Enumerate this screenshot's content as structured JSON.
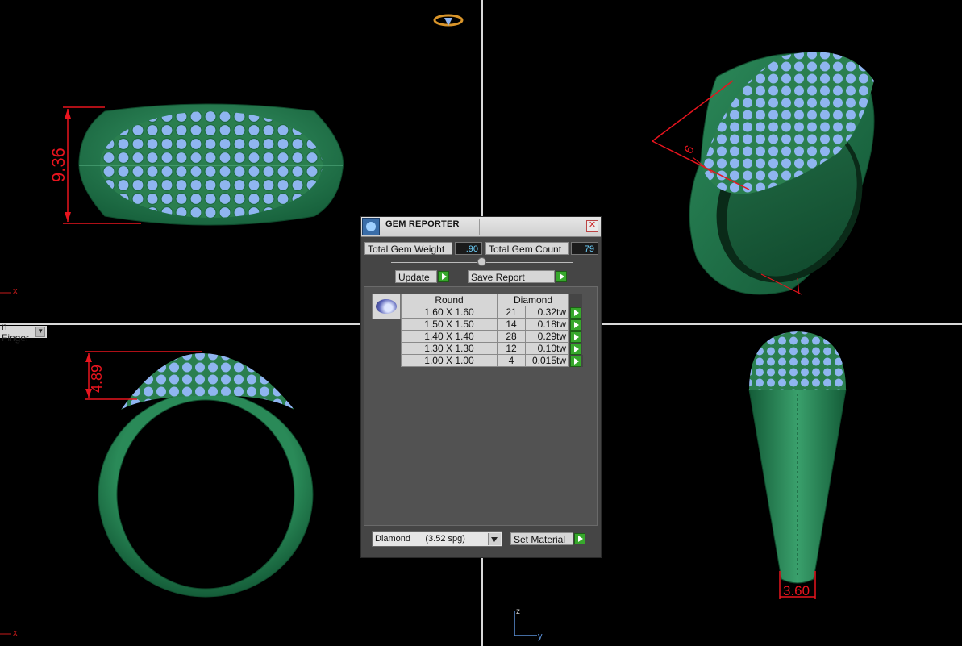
{
  "viewports": {
    "top_left": {
      "dimension": "9.36",
      "axis_label": "x"
    },
    "top_right": {
      "dimension": "6"
    },
    "bottom_left": {
      "view_name": "n Finger",
      "dimension": "4.89",
      "axis_label": "x"
    },
    "bottom_right": {
      "dimension": "3.60"
    }
  },
  "axes_widget": {
    "z": "z",
    "y": "y"
  },
  "dialog": {
    "title": "GEM REPORTER",
    "total_weight_label": "Total Gem Weight",
    "total_weight_value": ".90",
    "total_count_label": "Total Gem Count",
    "total_count_value": "79",
    "update_label": "Update",
    "save_report_label": "Save Report",
    "table": {
      "col_shape": "Round",
      "col_material": "Diamond",
      "rows": [
        {
          "size": "1.60 X 1.60",
          "count": "21",
          "weight": "0.32tw"
        },
        {
          "size": "1.50 X 1.50",
          "count": "14",
          "weight": "0.18tw"
        },
        {
          "size": "1.40 X 1.40",
          "count": "28",
          "weight": "0.29tw"
        },
        {
          "size": "1.30 X 1.30",
          "count": "12",
          "weight": "0.10tw"
        },
        {
          "size": "1.00 X 1.00",
          "count": "4",
          "weight": "0.015tw"
        }
      ]
    },
    "material_select": "Diamond      (3.52 spg)",
    "set_material_label": "Set Material"
  },
  "colors": {
    "metal": "#1f7a4c",
    "gem": "#8fb5f0",
    "dimension": "#e8141e"
  }
}
